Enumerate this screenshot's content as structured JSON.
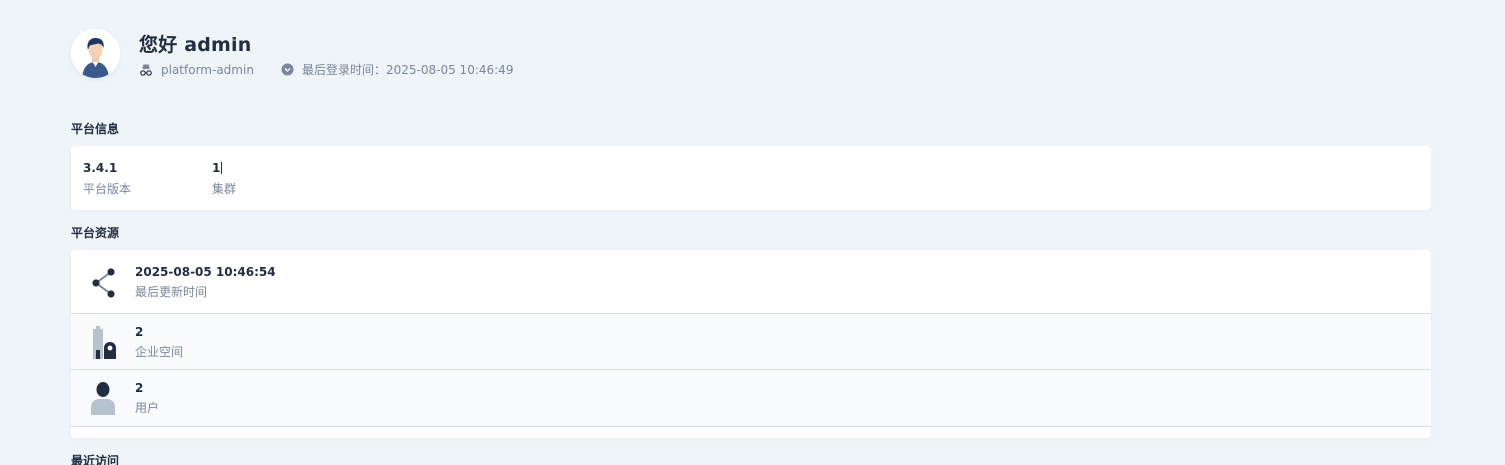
{
  "user": {
    "greeting": "您好 admin",
    "role": "platform-admin",
    "last_login": "最后登录时间：2025-08-05 10:46:49"
  },
  "platform_info": {
    "title": "平台信息",
    "version_value": "3.4.1",
    "version_label": "平台版本",
    "cluster_value": "1",
    "cluster_label": "集群"
  },
  "platform_resources": {
    "title": "平台资源",
    "items": [
      {
        "value": "2025-08-05 10:46:54",
        "label": "最后更新时间",
        "icon": "share-nodes-icon"
      },
      {
        "value": "2",
        "label": "企业空间",
        "icon": "workspace-icon"
      },
      {
        "value": "2",
        "label": "用户",
        "icon": "user-icon"
      }
    ]
  },
  "recent": {
    "title": "最近访问"
  },
  "colors": {
    "background": "#eff4f9",
    "card": "#ffffff",
    "text_primary": "#242e42",
    "text_secondary": "#79879c"
  }
}
